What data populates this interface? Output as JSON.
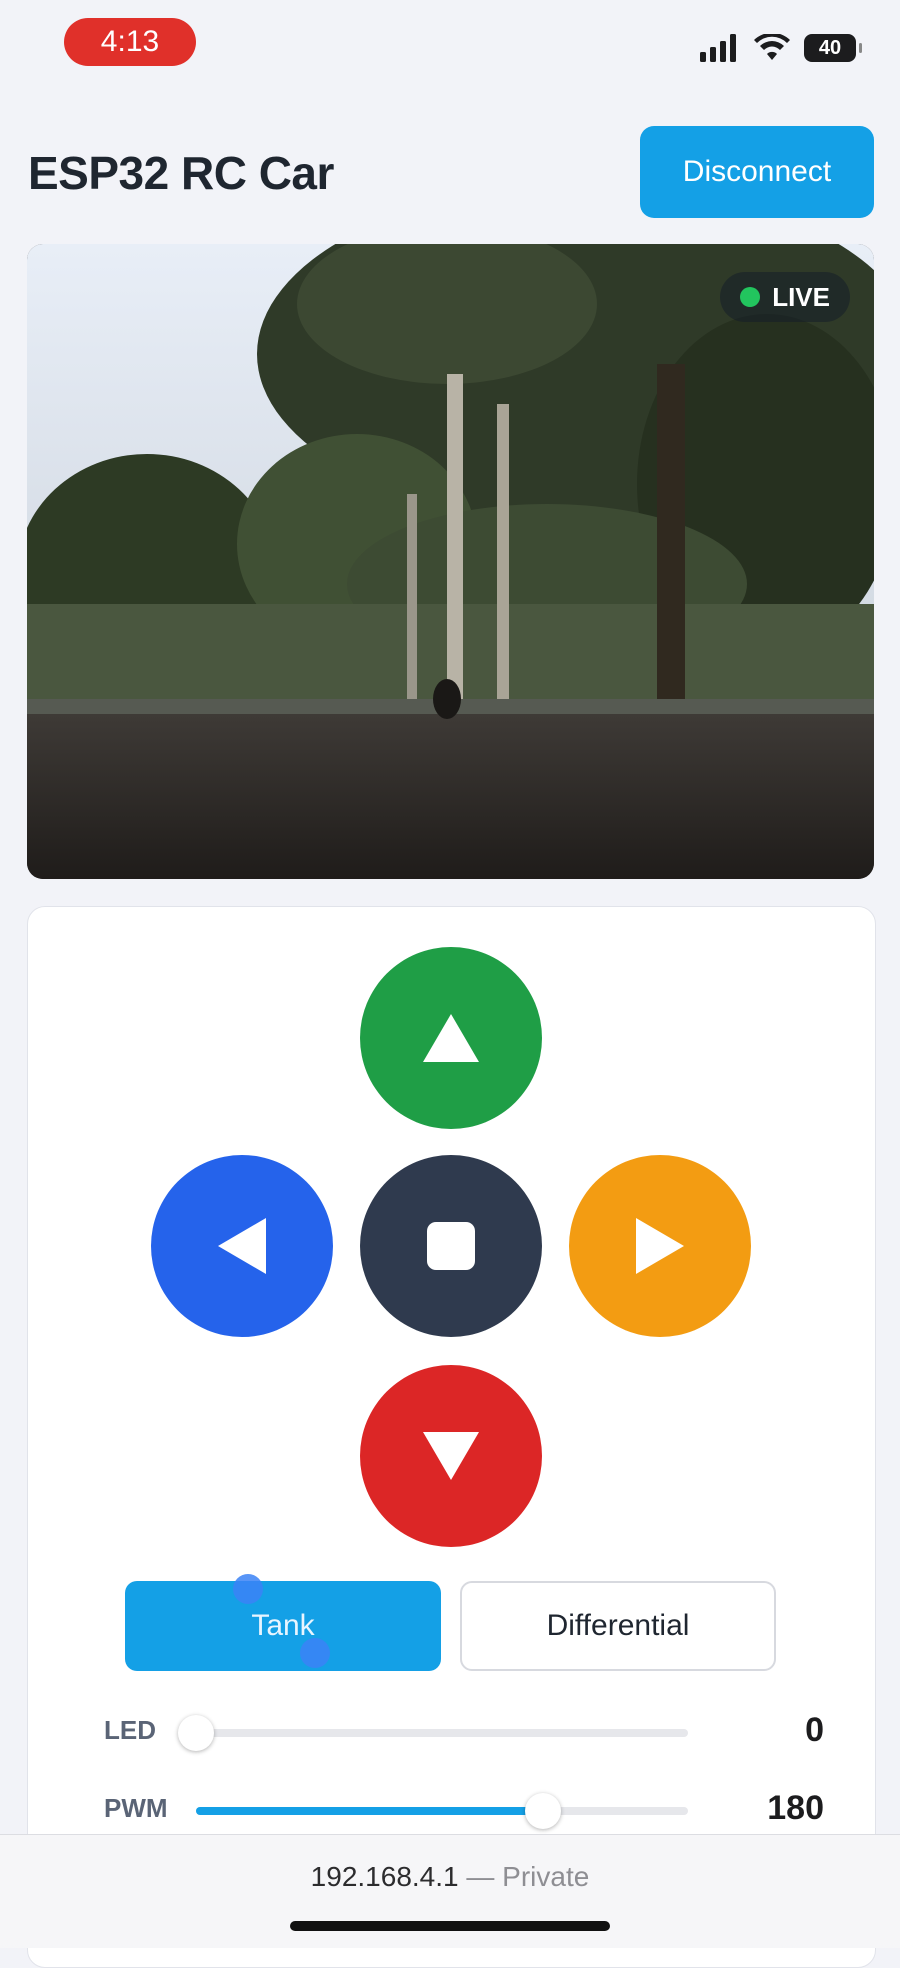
{
  "status_bar": {
    "time": "4:13",
    "battery": "40"
  },
  "header": {
    "title": "ESP32 RC Car",
    "disconnect_label": "Disconnect"
  },
  "video": {
    "live_label": "LIVE"
  },
  "controls": {
    "modes": [
      {
        "label": "Tank",
        "active": true
      },
      {
        "label": "Differential",
        "active": false
      }
    ],
    "sliders": [
      {
        "label": "LED",
        "value": "0",
        "fraction": 0.0
      },
      {
        "label": "PWM",
        "value": "180",
        "fraction": 0.706
      }
    ]
  },
  "bottom_bar": {
    "url": "192.168.4.1",
    "separator": " — ",
    "privacy": "Private"
  },
  "colors": {
    "accent": "#14a0e6",
    "forward": "#1f9e46",
    "left": "#2563eb",
    "stop": "#2f3a4e",
    "right": "#f39c12",
    "back": "#dc2626"
  }
}
